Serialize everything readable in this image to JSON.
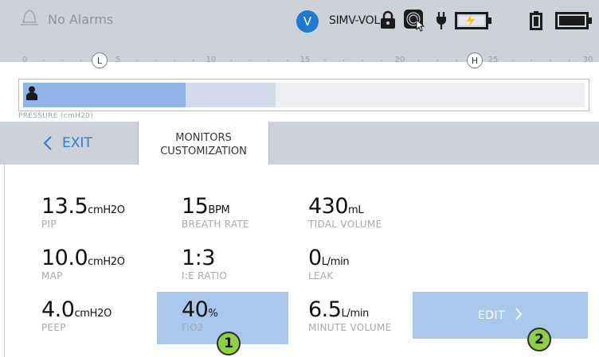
{
  "status_bar": {
    "alarm_text": "No Alarms",
    "mode_badge": "V",
    "mode_text": "SIMV-VOL",
    "icons": [
      "bell-icon",
      "lock-icon",
      "touch-lock-icon",
      "power-plug-icon",
      "battery-charging-icon",
      "battery-vertical-icon",
      "battery-full-icon"
    ]
  },
  "ruler": {
    "ticks": [
      "0",
      "5",
      "10",
      "15",
      "20",
      "25",
      "30"
    ],
    "low_marker": "L",
    "high_marker": "H",
    "pressure_label": "PRESSURE (cmH20)"
  },
  "pressure_bar": {
    "current_fraction": 0.29,
    "peak_fraction": 0.45
  },
  "tabs": {
    "exit_label": "EXIT",
    "active_tab_line1": "MONITORS",
    "active_tab_line2": "CUSTOMIZATION"
  },
  "monitors": [
    {
      "value": "13.5",
      "unit": "cmH2O",
      "label": "PIP"
    },
    {
      "value": "15",
      "unit": "BPM",
      "label": "BREATH RATE"
    },
    {
      "value": "430",
      "unit": "mL",
      "label": "TIDAL VOLUME"
    },
    {
      "value": "10.0",
      "unit": "cmH2O",
      "label": "MAP"
    },
    {
      "value": "1:3",
      "unit": "",
      "label": "I:E RATIO"
    },
    {
      "value": "0",
      "unit": "L/min",
      "label": "LEAK"
    },
    {
      "value": "4.0",
      "unit": "cmH2O",
      "label": "PEEP"
    },
    {
      "value": "40",
      "unit": "%",
      "label": "FiO2"
    },
    {
      "value": "6.5",
      "unit": "L/min",
      "label": "MINUTE VOLUME"
    }
  ],
  "edit_button": {
    "label": "EDIT"
  },
  "callouts": [
    "1",
    "2"
  ],
  "colors": {
    "accent_blue": "#2e7cd6",
    "highlight_fill": "#a9c8ec",
    "callout_green": "#8ecf46",
    "bar_fill": "#8fb4e6"
  }
}
